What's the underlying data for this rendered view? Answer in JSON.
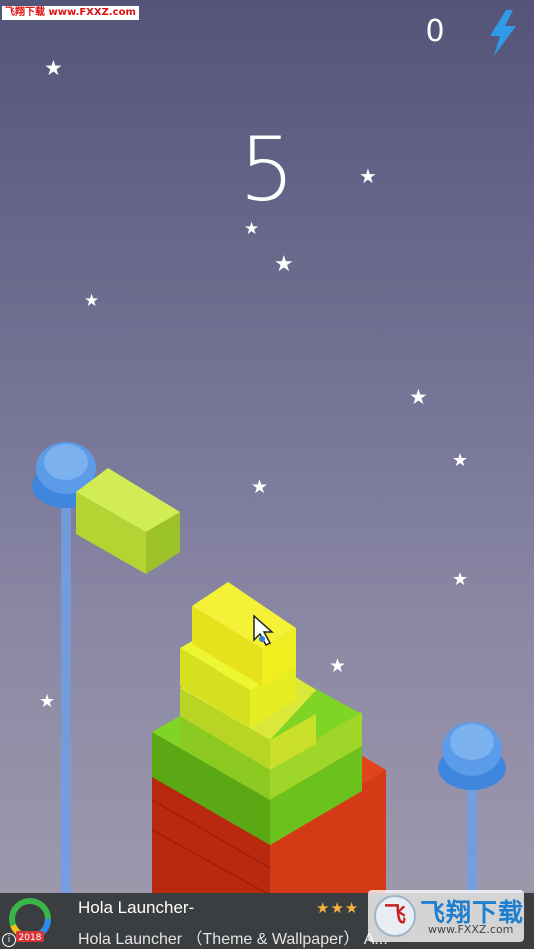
{
  "watermark_top": "飞翔下载 www.FXXZ.com",
  "hud": {
    "energy_count": "0",
    "energy_icon": "lightning-bolt-icon",
    "score": "5"
  },
  "scene": {
    "stack_colors": [
      "#c42a14",
      "#5fbd1a",
      "#a6d81a",
      "#d8e81f",
      "#f2f21b"
    ],
    "moving_block_color": "#c9e74a",
    "tree_color": "#3f8fe0",
    "cursor_icon": "mouse-cursor-icon"
  },
  "ad": {
    "logo_badge": "2018",
    "title": "Hola Launcher-",
    "description": "Hola Launcher （Theme & Wallpaper） A...",
    "rating_stars": "★★★",
    "info_icon": "i"
  },
  "watermark_bottom": {
    "brand": "飞翔下载",
    "url": "www.FXXZ.com",
    "icon_glyph": "飞"
  }
}
